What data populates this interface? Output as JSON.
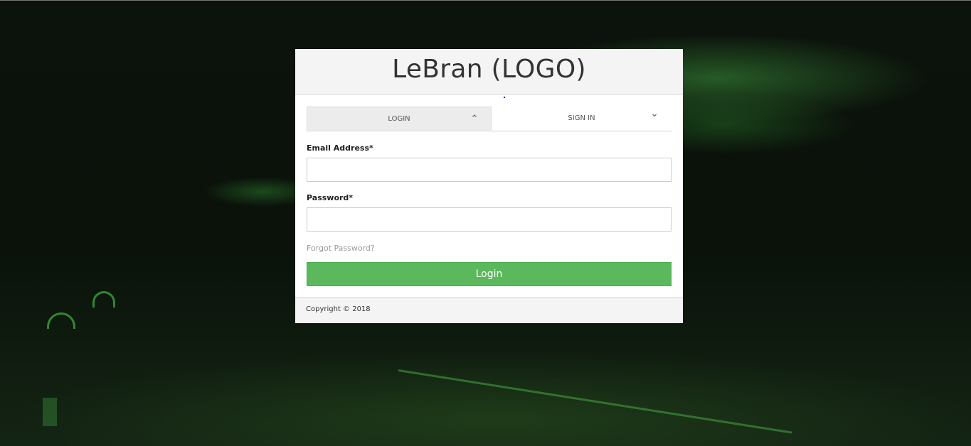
{
  "brand": {
    "logo_text": "LeBran (LOGO)"
  },
  "tabs": [
    {
      "label": "LOGIN",
      "active": true,
      "chevron": "chevron-up-icon"
    },
    {
      "label": "SIGN IN",
      "active": false,
      "chevron": "chevron-down-icon"
    }
  ],
  "form": {
    "email_label": "Email Address*",
    "email_value": "",
    "password_label": "Password*",
    "password_value": "",
    "forgot_link": "Forgot Password?",
    "submit_label": "Login"
  },
  "footer": {
    "copyright": "Copyright © 2018"
  },
  "colors": {
    "accent": "#5cb85c",
    "header_bg": "#f4f4f4",
    "tab_active_bg": "#ececec",
    "page_bg": "#0c120c"
  }
}
